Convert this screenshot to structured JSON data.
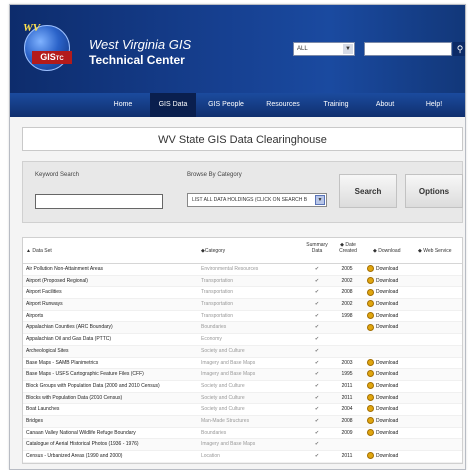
{
  "header": {
    "title_line1": "West Virginia GIS",
    "title_line2": "Technical Center",
    "logo_wv": "WV",
    "logo_gis": "GIS",
    "logo_tc": "TC",
    "search_scope": "ALL",
    "search_value": "",
    "search_icon": "magnifier-icon"
  },
  "nav": [
    "Home",
    "GIS Data",
    "GIS People",
    "Resources",
    "Training",
    "About",
    "Help!"
  ],
  "nav_active": "GIS Data",
  "banner": "WV State GIS Data Clearinghouse",
  "search_box": {
    "keyword_label": "Keyword Search",
    "keyword_value": "",
    "category_label": "Browse By Category",
    "category_value": "LIST ALL DATA HOLDINGS (CLICK ON SEARCH B",
    "search_button": "Search",
    "options_button": "Options"
  },
  "table": {
    "columns": [
      "Data Set",
      "Category",
      "Summary Data",
      "Date Created",
      "Download",
      "Web Service"
    ],
    "rows": [
      {
        "name": "Air Pollution Non-Attainment Areas",
        "category": "Environmental Resources",
        "summary": "✔",
        "date": "2005",
        "download": "Download"
      },
      {
        "name": "Airport (Proposed Regional)",
        "category": "Transportation",
        "summary": "✔",
        "date": "2002",
        "download": "Download"
      },
      {
        "name": "Airport Facilities",
        "category": "Transportation",
        "summary": "✔",
        "date": "2008",
        "download": "Download"
      },
      {
        "name": "Airport Runways",
        "category": "Transportation",
        "summary": "✔",
        "date": "2002",
        "download": "Download"
      },
      {
        "name": "Airports",
        "category": "Transportation",
        "summary": "✔",
        "date": "1998",
        "download": "Download"
      },
      {
        "name": "Appalachian Counties (ARC Boundary)",
        "category": "Boundaries",
        "summary": "✔",
        "date": "",
        "download": "Download"
      },
      {
        "name": "Appalachian Oil and Gas Data (PTTC)",
        "category": "Economy",
        "summary": "✔",
        "date": "",
        "download": ""
      },
      {
        "name": "Archeological Sites",
        "category": "Society and Culture",
        "summary": "✔",
        "date": "",
        "download": ""
      },
      {
        "name": "Base Maps - SAMB Planimetrics",
        "category": "Imagery and Base Maps",
        "summary": "✔",
        "date": "2003",
        "download": "Download"
      },
      {
        "name": "Base Maps - USFS Cartographic Feature Files (CFF)",
        "category": "Imagery and Base Maps",
        "summary": "✔",
        "date": "1995",
        "download": "Download"
      },
      {
        "name": "Block Groups with Population Data (2000 and 2010 Census)",
        "category": "Society and Culture",
        "summary": "✔",
        "date": "2011",
        "download": "Download"
      },
      {
        "name": "Blocks with Population Data (2010 Census)",
        "category": "Society and Culture",
        "summary": "✔",
        "date": "2011",
        "download": "Download"
      },
      {
        "name": "Boat Launches",
        "category": "Society and Culture",
        "summary": "✔",
        "date": "2004",
        "download": "Download"
      },
      {
        "name": "Bridges",
        "category": "Man-Made Structures",
        "summary": "✔",
        "date": "2008",
        "download": "Download"
      },
      {
        "name": "Canaan Valley National Wildlife Refuge Boundary",
        "category": "Boundaries",
        "summary": "✔",
        "date": "2009",
        "download": "Download"
      },
      {
        "name": "Catalogue of Aerial Historical Photos (1936 - 1976)",
        "category": "Imagery and Base Maps",
        "summary": "✔",
        "date": "",
        "download": ""
      },
      {
        "name": "Census - Urbanized Areas (1990 and 2000)",
        "category": "Location",
        "summary": "✔",
        "date": "2011",
        "download": "Download"
      }
    ]
  }
}
